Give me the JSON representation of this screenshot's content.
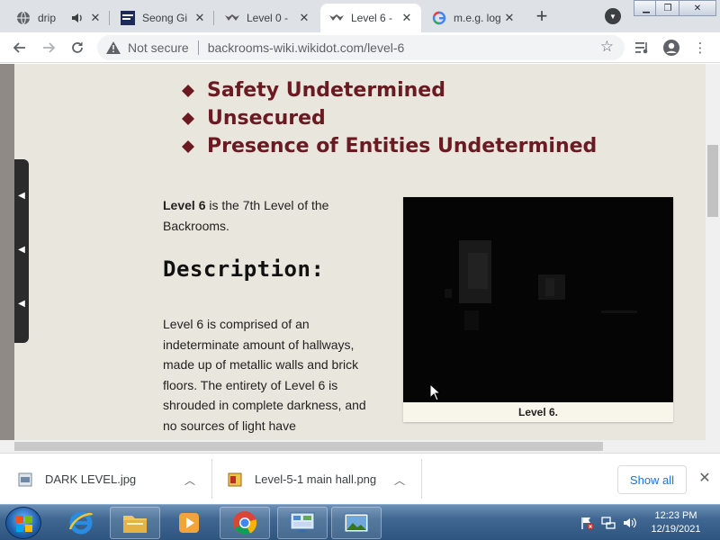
{
  "browser": {
    "tabs": [
      {
        "title": "drip",
        "favicon": "globe-icon",
        "audio": true,
        "active": false
      },
      {
        "title": "Seong Gi",
        "favicon": "site-thumbnail-icon",
        "active": false
      },
      {
        "title": "Level 0 -",
        "favicon": "backrooms-logo-icon",
        "active": false
      },
      {
        "title": "Level 6 -",
        "favicon": "backrooms-logo-icon",
        "active": true
      },
      {
        "title": "m.e.g. log",
        "favicon": "google-g-icon",
        "active": false
      }
    ],
    "new_tab_symbol": "+",
    "address": {
      "security_label": "Not secure",
      "url": "backrooms-wiki.wikidot.com/level-6"
    }
  },
  "page": {
    "class_items": [
      "Safety Undetermined",
      "Unsecured",
      "Presence of Entities Undetermined"
    ],
    "intro": {
      "bold": "Level 6",
      "rest": " is the 7th Level of the Backrooms."
    },
    "heading": "Description:",
    "body": "Level 6 is comprised of an indeterminate amount of hallways, made up of metallic walls and brick floors. The entirety of Level 6 is shrouded in complete darkness, and no sources of light have",
    "figure_caption": "Level 6.",
    "accent_color": "#6b1a22"
  },
  "downloads": {
    "items": [
      {
        "name": "DARK LEVEL.jpg",
        "icon": "image-file-icon"
      },
      {
        "name": "Level-5-1 main hall.png",
        "icon": "image-file-icon"
      }
    ],
    "show_all": "Show all"
  },
  "taskbar": {
    "apps": [
      "internet-explorer-icon",
      "windows-explorer-icon",
      "media-player-icon",
      "chrome-icon",
      "control-panel-icon",
      "photo-viewer-icon"
    ],
    "time": "12:23 PM",
    "date": "12/19/2021"
  }
}
